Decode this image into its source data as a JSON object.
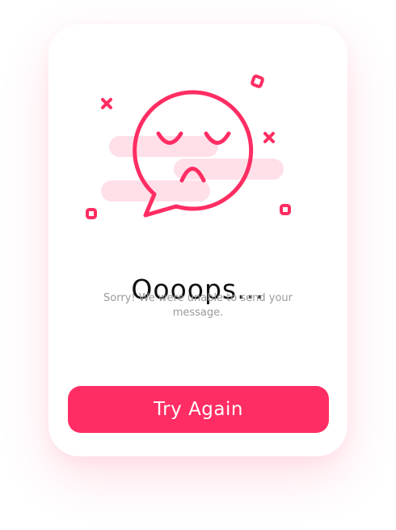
{
  "dialog": {
    "title": "Oooops...",
    "message": "Sorry! We were unable to send your message.",
    "button_label": "Try Again"
  },
  "illustration": {
    "icon": "sad-speech-bubble-icon",
    "decorations": [
      "x-mark-icon",
      "square-icon"
    ]
  },
  "colors": {
    "accent": "#ff2d63",
    "soft_accent": "#ffe0e8",
    "title": "#111111",
    "message": "#9a9a9a",
    "button_text": "#ffffff"
  }
}
